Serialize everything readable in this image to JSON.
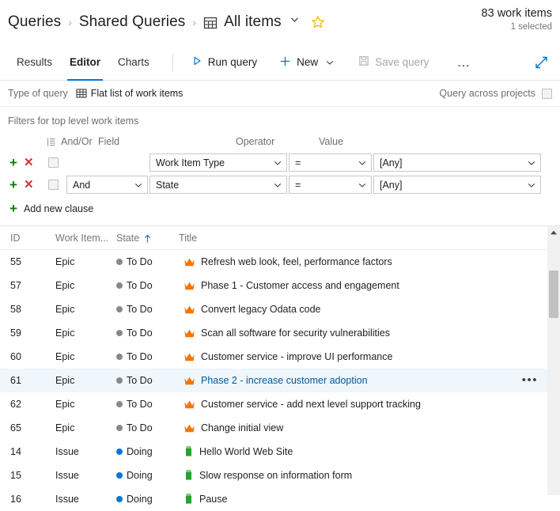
{
  "breadcrumb": {
    "root": "Queries",
    "folder": "Shared Queries",
    "query_name": "All items",
    "separator": "›",
    "grid_icon": "table-grid-icon",
    "chevron_icon": "chevron-down-icon",
    "star_icon": "favorite-star-icon"
  },
  "count_panel": {
    "work_items": "83 work items",
    "selected": "1 selected"
  },
  "tabs": [
    {
      "label": "Results",
      "selected": false
    },
    {
      "label": "Editor",
      "selected": true
    },
    {
      "label": "Charts",
      "selected": false
    }
  ],
  "toolbar": {
    "run_query": "Run query",
    "run_icon": "play-triangle-icon",
    "new": "New",
    "new_icon": "plus-icon",
    "new_chevron": "chevron-down-icon",
    "save_query": "Save query",
    "save_icon": "floppy-disk-icon",
    "save_disabled": true,
    "more": "…",
    "more_icon": "ellipsis-icon",
    "expand_icon": "full-screen-expand-icon"
  },
  "query_type": {
    "label": "Type of query",
    "value": "Flat list of work items",
    "icon": "flat-list-grid-icon",
    "across_projects_label": "Query across projects",
    "across_projects_checked": false
  },
  "filters": {
    "section_title": "Filters for top level work items",
    "columns": {
      "group": "And/Or",
      "field": "Field",
      "operator": "Operator",
      "value": "Value",
      "group_icon": "group-clauses-icon"
    },
    "clauses": [
      {
        "add_icon": "plus-icon",
        "delete_icon": "delete-x-icon",
        "checked": false,
        "andor": "",
        "field": "Work Item Type",
        "operator": "=",
        "value": "[Any]",
        "show_andor": false
      },
      {
        "add_icon": "plus-icon",
        "delete_icon": "delete-x-icon",
        "checked": false,
        "andor": "And",
        "field": "State",
        "operator": "=",
        "value": "[Any]",
        "show_andor": true
      }
    ],
    "add_new_clause": "Add new clause",
    "add_new_clause_icon": "plus-icon"
  },
  "grid": {
    "columns": {
      "id": "ID",
      "work_item_type": "Work Item...",
      "state": "State",
      "title": "Title",
      "sort_icon": "sort-ascending-arrow-icon",
      "sorted_by": "State"
    },
    "colors": {
      "epic_icon": "#f2760f",
      "issue_icon": "#2f9e2f",
      "todo_dot": "#8a8886",
      "doing_dot": "#0078d4",
      "selected_row_bg": "#eff6fc",
      "selected_title": "#005a9e",
      "accent": "#0078d4"
    },
    "rows": [
      {
        "id": "55",
        "type": "Epic",
        "state": "To Do",
        "title": "Refresh web look, feel, performance factors",
        "icon": "epic-crown-icon",
        "selected": false
      },
      {
        "id": "57",
        "type": "Epic",
        "state": "To Do",
        "title": "Phase 1 - Customer access and engagement",
        "icon": "epic-crown-icon",
        "selected": false
      },
      {
        "id": "58",
        "type": "Epic",
        "state": "To Do",
        "title": "Convert legacy Odata code",
        "icon": "epic-crown-icon",
        "selected": false
      },
      {
        "id": "59",
        "type": "Epic",
        "state": "To Do",
        "title": "Scan all software for security vulnerabilities",
        "icon": "epic-crown-icon",
        "selected": false
      },
      {
        "id": "60",
        "type": "Epic",
        "state": "To Do",
        "title": "Customer service - improve UI performance",
        "icon": "epic-crown-icon",
        "selected": false
      },
      {
        "id": "61",
        "type": "Epic",
        "state": "To Do",
        "title": "Phase 2 - increase customer adoption",
        "icon": "epic-crown-icon",
        "selected": true,
        "row_menu": "•••"
      },
      {
        "id": "62",
        "type": "Epic",
        "state": "To Do",
        "title": "Customer service - add next level support tracking",
        "icon": "epic-crown-icon",
        "selected": false
      },
      {
        "id": "65",
        "type": "Epic",
        "state": "To Do",
        "title": "Change initial view",
        "icon": "epic-crown-icon",
        "selected": false
      },
      {
        "id": "14",
        "type": "Issue",
        "state": "Doing",
        "title": "Hello World Web Site",
        "icon": "issue-note-icon",
        "selected": false
      },
      {
        "id": "15",
        "type": "Issue",
        "state": "Doing",
        "title": "Slow response on information form",
        "icon": "issue-note-icon",
        "selected": false
      },
      {
        "id": "16",
        "type": "Issue",
        "state": "Doing",
        "title": "Pause",
        "icon": "issue-note-icon",
        "selected": false
      }
    ],
    "scrollbar": {
      "up_arrow_icon": "scroll-up-arrow-icon"
    }
  }
}
